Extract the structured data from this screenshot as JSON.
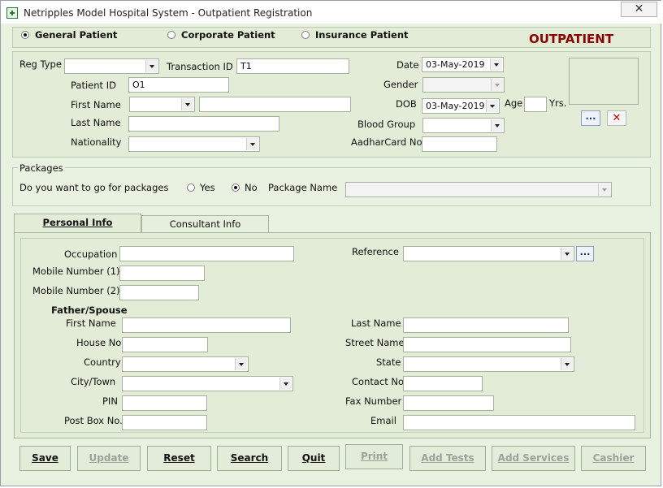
{
  "window": {
    "title": "Netripples Model Hospital System - Outpatient Registration",
    "close_glyph": "✕"
  },
  "patient_type": {
    "options": [
      "General Patient",
      "Corporate Patient",
      "Insurance Patient"
    ],
    "selected": "General Patient",
    "banner": "OUTPATIENT"
  },
  "header_form": {
    "reg_type_label": "Reg Type",
    "reg_type_value": "",
    "transaction_id_label": "Transaction ID",
    "transaction_id_value": "T1",
    "date_label": "Date",
    "date_value": "03-May-2019",
    "patient_id_label": "Patient ID",
    "patient_id_value": "O1",
    "gender_label": "Gender",
    "gender_value": "",
    "first_name_label": "First Name",
    "title_value": "",
    "first_name_value": "",
    "dob_label": "DOB",
    "dob_value": "03-May-2019",
    "age_label": "Age",
    "age_value": "",
    "yrs_label": "Yrs.",
    "last_name_label": "Last Name",
    "last_name_value": "",
    "blood_group_label": "Blood Group",
    "blood_group_value": "",
    "nationality_label": "Nationality",
    "nationality_value": "",
    "aadhar_label": "AadharCard No",
    "aadhar_value": "",
    "browse_photo_label": "...",
    "remove_photo_label": "✕"
  },
  "packages": {
    "group_label": "Packages",
    "question": "Do you want to go for packages",
    "yes_label": "Yes",
    "no_label": "No",
    "selected": "No",
    "package_name_label": "Package Name",
    "package_name_value": ""
  },
  "tabs": [
    {
      "label": "Personal Info",
      "active": true
    },
    {
      "label": "Consultant Info",
      "active": false
    }
  ],
  "personal_info": {
    "occupation_label": "Occupation",
    "occupation_value": "",
    "reference_label": "Reference",
    "reference_value": "",
    "reference_browse": "...",
    "mobile1_label": "Mobile Number (1)",
    "mobile1_value": "",
    "mobile2_label": "Mobile Number (2)",
    "mobile2_value": "",
    "father_spouse_label": "Father/Spouse",
    "fs_first_name_label": "First Name",
    "fs_first_name_value": "",
    "fs_last_name_label": "Last Name",
    "fs_last_name_value": "",
    "house_no_label": "House No",
    "house_no_value": "",
    "street_name_label": "Street Name",
    "street_name_value": "",
    "country_label": "Country",
    "country_value": "",
    "state_label": "State",
    "state_value": "",
    "city_label": "City/Town",
    "city_value": "",
    "contact_no_label": "Contact No",
    "contact_no_value": "",
    "pin_label": "PIN",
    "pin_value": "",
    "fax_label": "Fax Number",
    "fax_value": "",
    "post_box_label": "Post Box No.",
    "post_box_value": "",
    "email_label": "Email",
    "email_value": ""
  },
  "buttons": [
    {
      "label": "Save",
      "enabled": true
    },
    {
      "label": "Update",
      "enabled": false
    },
    {
      "label": "Reset",
      "enabled": true
    },
    {
      "label": "Search",
      "enabled": true
    },
    {
      "label": "Quit",
      "enabled": true
    },
    {
      "label": "Print",
      "enabled": false
    },
    {
      "label": "Add Tests",
      "enabled": false
    },
    {
      "label": "Add Services",
      "enabled": false
    },
    {
      "label": "Cashier",
      "enabled": false
    }
  ],
  "colors": {
    "banner": "#8b0000",
    "form_bg": "#e2ecd6",
    "window_bg": "#e9f2e1"
  }
}
